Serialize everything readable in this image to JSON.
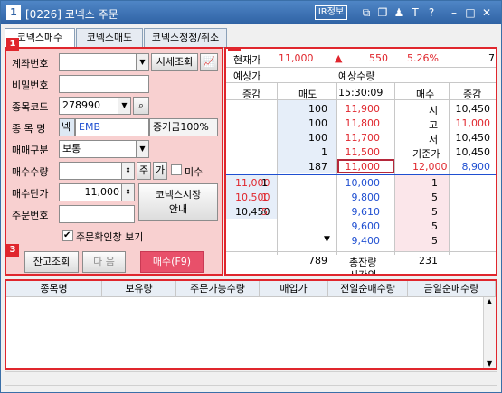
{
  "window": {
    "num": "1",
    "title": "[0226] 코넥스 주문",
    "ir_label": "IR정보",
    "icons": [
      "link-icon",
      "copy-icon",
      "pin-icon",
      "font-icon",
      "help-icon",
      "minimize-icon",
      "maximize-icon",
      "close-icon"
    ]
  },
  "tabs": [
    {
      "label": "코넥스매수",
      "active": true
    },
    {
      "label": "코넥스매도",
      "active": false
    },
    {
      "label": "코넥스정정/취소",
      "active": false
    }
  ],
  "badges": [
    "1",
    "2",
    "3"
  ],
  "order": {
    "account_label": "계좌번호",
    "account_value": "",
    "detail_button": "시세조회",
    "password_label": "비밀번호",
    "password_value": "",
    "code_label": "종목코드",
    "code_value": "278990",
    "name_label": "종 목 명",
    "market_tag": "넥",
    "name_value": "EMB",
    "margin_label": "증거금100%",
    "type_label": "매매구분",
    "type_value": "보통",
    "qty_label": "매수수량",
    "qty_value": "",
    "qty_btn1": "주",
    "qty_btn2": "가",
    "uncheck_label": "미수",
    "price_label": "매수단가",
    "price_value": "11,000",
    "market_guide_btn": "코넥스시장\n안내",
    "order_no_label": "주문번호",
    "order_no_value": "",
    "confirm_label": "주문확인창 보기",
    "balance_btn": "잔고조회",
    "next_btn": "다 음",
    "buy_btn": "매수(F9)"
  },
  "quote": {
    "current_label": "현재가",
    "current_value": "11,000",
    "change_value": "550",
    "change_pct": "5.26%",
    "extra_value": "7",
    "expected_label": "예상가",
    "expected_qty_label": "예상수량",
    "headers": [
      "증감",
      "매도",
      "15:30:09",
      "매수",
      "증감"
    ],
    "asks": [
      {
        "qty": "100",
        "price": "11,900",
        "label": "시",
        "info": "10,450"
      },
      {
        "qty": "100",
        "price": "11,800",
        "label": "고",
        "info": "11,000"
      },
      {
        "qty": "100",
        "price": "11,700",
        "label": "저",
        "info": "10,450"
      },
      {
        "qty": "1",
        "price": "11,500",
        "label": "기준가",
        "info": "10,450"
      },
      {
        "qty": "187",
        "price": "11,000",
        "label": "12,000",
        "info": "8,900"
      }
    ],
    "bids": [
      {
        "left": "11,000",
        "mid": "1",
        "price": "10,000",
        "qty": "1"
      },
      {
        "left": "10,500",
        "mid": "1",
        "price": "9,800",
        "qty": "5"
      },
      {
        "left": "10,450",
        "mid": "5",
        "price": "9,610",
        "qty": "5"
      },
      {
        "left": "",
        "mid": "",
        "price": "9,600",
        "qty": "5"
      },
      {
        "left": "",
        "mid": "",
        "price": "9,400",
        "qty": "5"
      }
    ],
    "total_ask": "789",
    "total_label": "총잔량",
    "after_label": "시간외",
    "total_bid": "231"
  },
  "balance": {
    "headers": [
      "종목명",
      "보유량",
      "주문가능수량",
      "매입가",
      "전일순매수량",
      "금일순매수량"
    ]
  },
  "colors": {
    "up": "#e0262d",
    "down": "#1f4fd1",
    "accent_border": "#e0262d",
    "buy_button": "#e8506a"
  }
}
